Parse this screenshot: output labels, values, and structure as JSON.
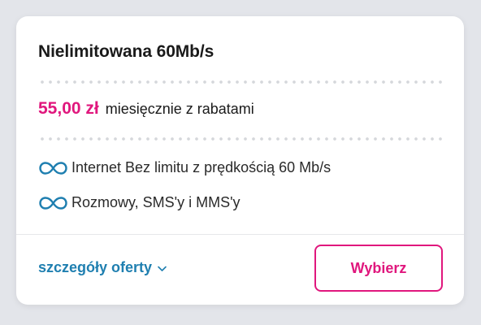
{
  "offer": {
    "title": "Nielimitowana 60Mb/s",
    "price": "55,00 zł",
    "price_description": "miesięcznie z rabatami",
    "features": [
      {
        "icon": "infinity-icon",
        "text": "Internet Bez limitu z prędkością 60 Mb/s"
      },
      {
        "icon": "infinity-icon",
        "text": "Rozmowy, SMS'y i MMS'y"
      }
    ]
  },
  "footer": {
    "details_label": "szczegóły oferty",
    "choose_label": "Wybierz"
  },
  "colors": {
    "accent": "#e0177d",
    "link": "#1f7fb0",
    "icon": "#1f7fb0",
    "background": "#e3e5ea"
  }
}
